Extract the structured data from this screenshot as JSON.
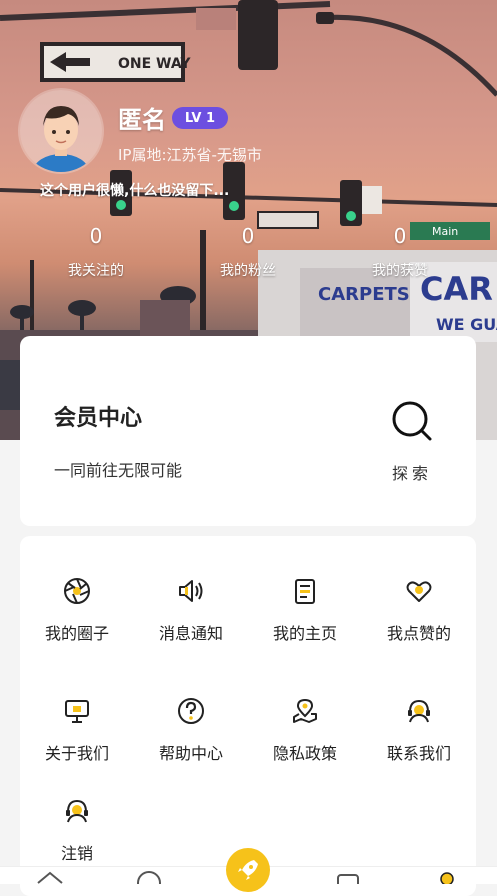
{
  "profile": {
    "name": "匿名",
    "level": "LV 1",
    "ip_location": "IP属地:江苏省-无锡市",
    "bio": "这个用户很懒,什么也没留下..."
  },
  "stats": [
    {
      "value": "0",
      "label": "我关注的"
    },
    {
      "value": "0",
      "label": "我的粉丝"
    },
    {
      "value": "0",
      "label": "我的获赞"
    }
  ],
  "vip": {
    "title": "会员中心",
    "subtitle": "一同前往无限可能",
    "explore_label": "探索"
  },
  "menu": [
    {
      "label": "我的圈子",
      "icon": "aperture-icon"
    },
    {
      "label": "消息通知",
      "icon": "speaker-icon"
    },
    {
      "label": "我的主页",
      "icon": "document-icon"
    },
    {
      "label": "我点赞的",
      "icon": "heart-icon"
    },
    {
      "label": "关于我们",
      "icon": "monitor-icon"
    },
    {
      "label": "帮助中心",
      "icon": "question-icon"
    },
    {
      "label": "隐私政策",
      "icon": "map-pin-icon"
    },
    {
      "label": "联系我们",
      "icon": "headset-icon"
    },
    {
      "label": "注销",
      "icon": "headset-icon"
    }
  ],
  "colors": {
    "accent": "#f6c21a",
    "badge": "#6c4fe0",
    "icon_stroke": "#222222"
  },
  "background_signs": {
    "one_way": "ONE WAY",
    "main_st": "Main"
  }
}
